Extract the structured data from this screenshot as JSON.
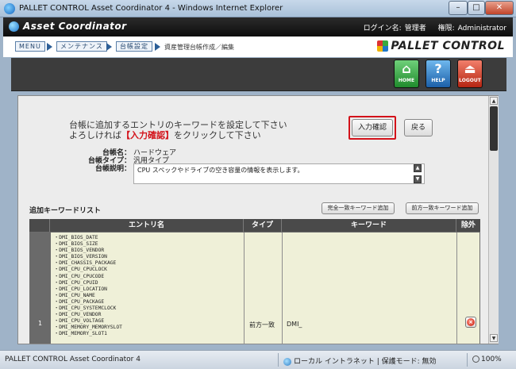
{
  "window": {
    "title": "PALLET CONTROL Asset Coordinator 4 - Windows Internet Explorer",
    "min": "–",
    "max": "□",
    "close": "✕"
  },
  "header": {
    "app_name": "Asset Coordinator",
    "login_label": "ログイン名:",
    "login_name": "管理者",
    "authority_label": "権限:",
    "authority_value": "Administrator"
  },
  "breadcrumb": {
    "items": [
      "MENU",
      "メンテナンス",
      "台帳設定"
    ],
    "current": "資産管理台帳作成／編集"
  },
  "brand": "PALLET CONTROL",
  "nav": {
    "home": "HOME",
    "help": "HELP",
    "logout": "LOGOUT"
  },
  "main": {
    "instruction_line1": "台帳に追加するエントリのキーワードを設定して下さい",
    "instruction_line2_pre": "よろしければ",
    "instruction_line2_highlight": "【入力確認】",
    "instruction_line2_post": "をクリックして下さい",
    "confirm_button": "入力確認",
    "back_button": "戻る",
    "ledger_name_label": "台帳名：",
    "ledger_name_value": "ハードウェア",
    "ledger_type_label": "台帳タイプ：",
    "ledger_type_value": "汎用タイプ",
    "ledger_desc_label": "台帳説明：",
    "ledger_desc_value": "CPU スペックやドライブの空き容量の情報を表示します。",
    "list_title": "追加キーワードリスト",
    "exact_match_button": "完全一致キーワード追加",
    "prefix_match_button": "前方一致キーワード追加"
  },
  "table": {
    "columns": [
      "エントリ名",
      "タイプ",
      "キーワード",
      "除外"
    ],
    "rows": [
      {
        "num": "1",
        "entries": [
          "・DMI_BIOS_DATE",
          "・DMI_BIOS_SIZE",
          "・DMI_BIOS_VENDOR",
          "・DMI_BIOS_VERSION",
          "・DMI_CHASSIS_PACKAGE",
          "・DMI_CPU_CPUCLOCK",
          "・DMI_CPU_CPUCODE",
          "・DMI_CPU_CPUID",
          "・DMI_CPU_LOCATION",
          "・DMI_CPU_NAME",
          "・DMI_CPU_PACKAGE",
          "・DMI_CPU_SYSTEMCLOCK",
          "・DMI_CPU_VENDOR",
          "・DMI_CPU_VOLTAGE",
          "・DMI_MEMORY_MEMORYSLOT",
          "・DMI_MEMORY_SLOT1"
        ],
        "type": "前方一致",
        "keyword": "DMI_"
      }
    ]
  },
  "statusbar": {
    "left": "PALLET CONTROL Asset Coordinator 4",
    "zone": "ローカル イントラネット | 保護モード: 無効",
    "zoom": "100%"
  },
  "icons": {
    "scroll_up": "▲",
    "scroll_down": "▼",
    "home_glyph": "⌂",
    "help_glyph": "?",
    "logout_glyph": "⏏",
    "delete_glyph": "×"
  }
}
